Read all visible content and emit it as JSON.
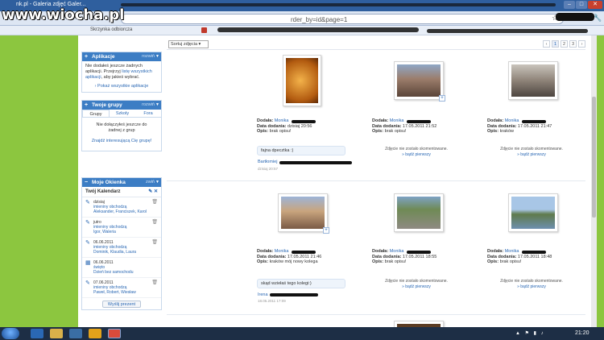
{
  "watermark": "www.wiocha.pl",
  "window": {
    "tab_title": "nk.pl - Galeria zdjęć Galer...",
    "min": "–",
    "max": "□",
    "close": "✕"
  },
  "address": {
    "url": "rder_by=id&page=1"
  },
  "bookmarks": [
    "Skrzynka odbiorcza"
  ],
  "sidebar": {
    "apps": {
      "title": "Aplikacje",
      "link": "rozwiń",
      "text_1": "Nie dodałeś jeszcze żadnych aplikacji. Przejrzyj ",
      "text_link": "listę wszystkich aplikacji",
      "text_2": ", aby jakieś wybrać.",
      "show_all": "Pokaż wszystkie aplikacje"
    },
    "groups": {
      "title": "Twoje grupy",
      "link": "rozwiń",
      "tabs": [
        "Grupy",
        "Szkoły",
        "Fora"
      ],
      "text": "Nie dołączyłeś jeszcze do żadnej z grup",
      "find": "Znajdź interesującą Cię grupę!"
    },
    "notes": {
      "title": "Moje Okienka",
      "link": "zwiń",
      "calendar_title": "Twój Kalendarz",
      "items": [
        {
          "date": "dzisiaj",
          "sub": "imieniny obchodzą",
          "names": "Aleksander, Franciszek, Karol"
        },
        {
          "date": "jutro",
          "sub": "imieniny obchodzą",
          "names": "Igor, Waleria"
        },
        {
          "date": "06.06.2011",
          "sub": "imieniny obchodzą",
          "names": "Dominik, Klaudia, Laura"
        },
        {
          "date": "06.06.2011",
          "sub": "święto",
          "names": "Dzień bez samochodu"
        },
        {
          "date": "07.06.2011",
          "sub": "imieniny obchodzą",
          "names": "Paweł, Robert, Wiesław"
        }
      ],
      "more": "Wyślij prezent"
    }
  },
  "main": {
    "sort_label": "Sortuj zdjęcia",
    "pager": [
      "‹",
      "1",
      "2",
      "3",
      "›"
    ],
    "labels": {
      "added_by": "Dodała:",
      "date": "Data dodania:",
      "desc": "Opis:"
    },
    "no_comment": "Zdjęcie nie zostało skomentowane.",
    "be_first": "» bądź pierwszy",
    "photos": [
      {
        "author": "Monika",
        "date": "dzisiaj 20:56",
        "desc": "brak opisu!",
        "comment": "fajna dpecztka :)",
        "commenter": "Bartłomiej",
        "comment_date": "dzisiaj 20:57"
      },
      {
        "author": "Monika",
        "date": "17.05.2011 21:52",
        "desc": "brak opisu!"
      },
      {
        "author": "Monika",
        "date": "17.05.2011 21:47",
        "desc": "kraków"
      },
      {
        "author": "Monika",
        "date": "17.05.2011 21:46",
        "desc": "kraków mój nowy kolega",
        "comment": "skąd wziełaś tego kolegi:)",
        "commenter": "Irena",
        "comment_date": "18.05.2011 17:09"
      },
      {
        "author": "Monika",
        "date": "17.05.2011 18:55",
        "desc": "brak opisu!"
      },
      {
        "author": "Monika",
        "date": "17.05.2011 18:48",
        "desc": "brak opisu!"
      }
    ]
  },
  "taskbar": {
    "time": "21:20"
  }
}
